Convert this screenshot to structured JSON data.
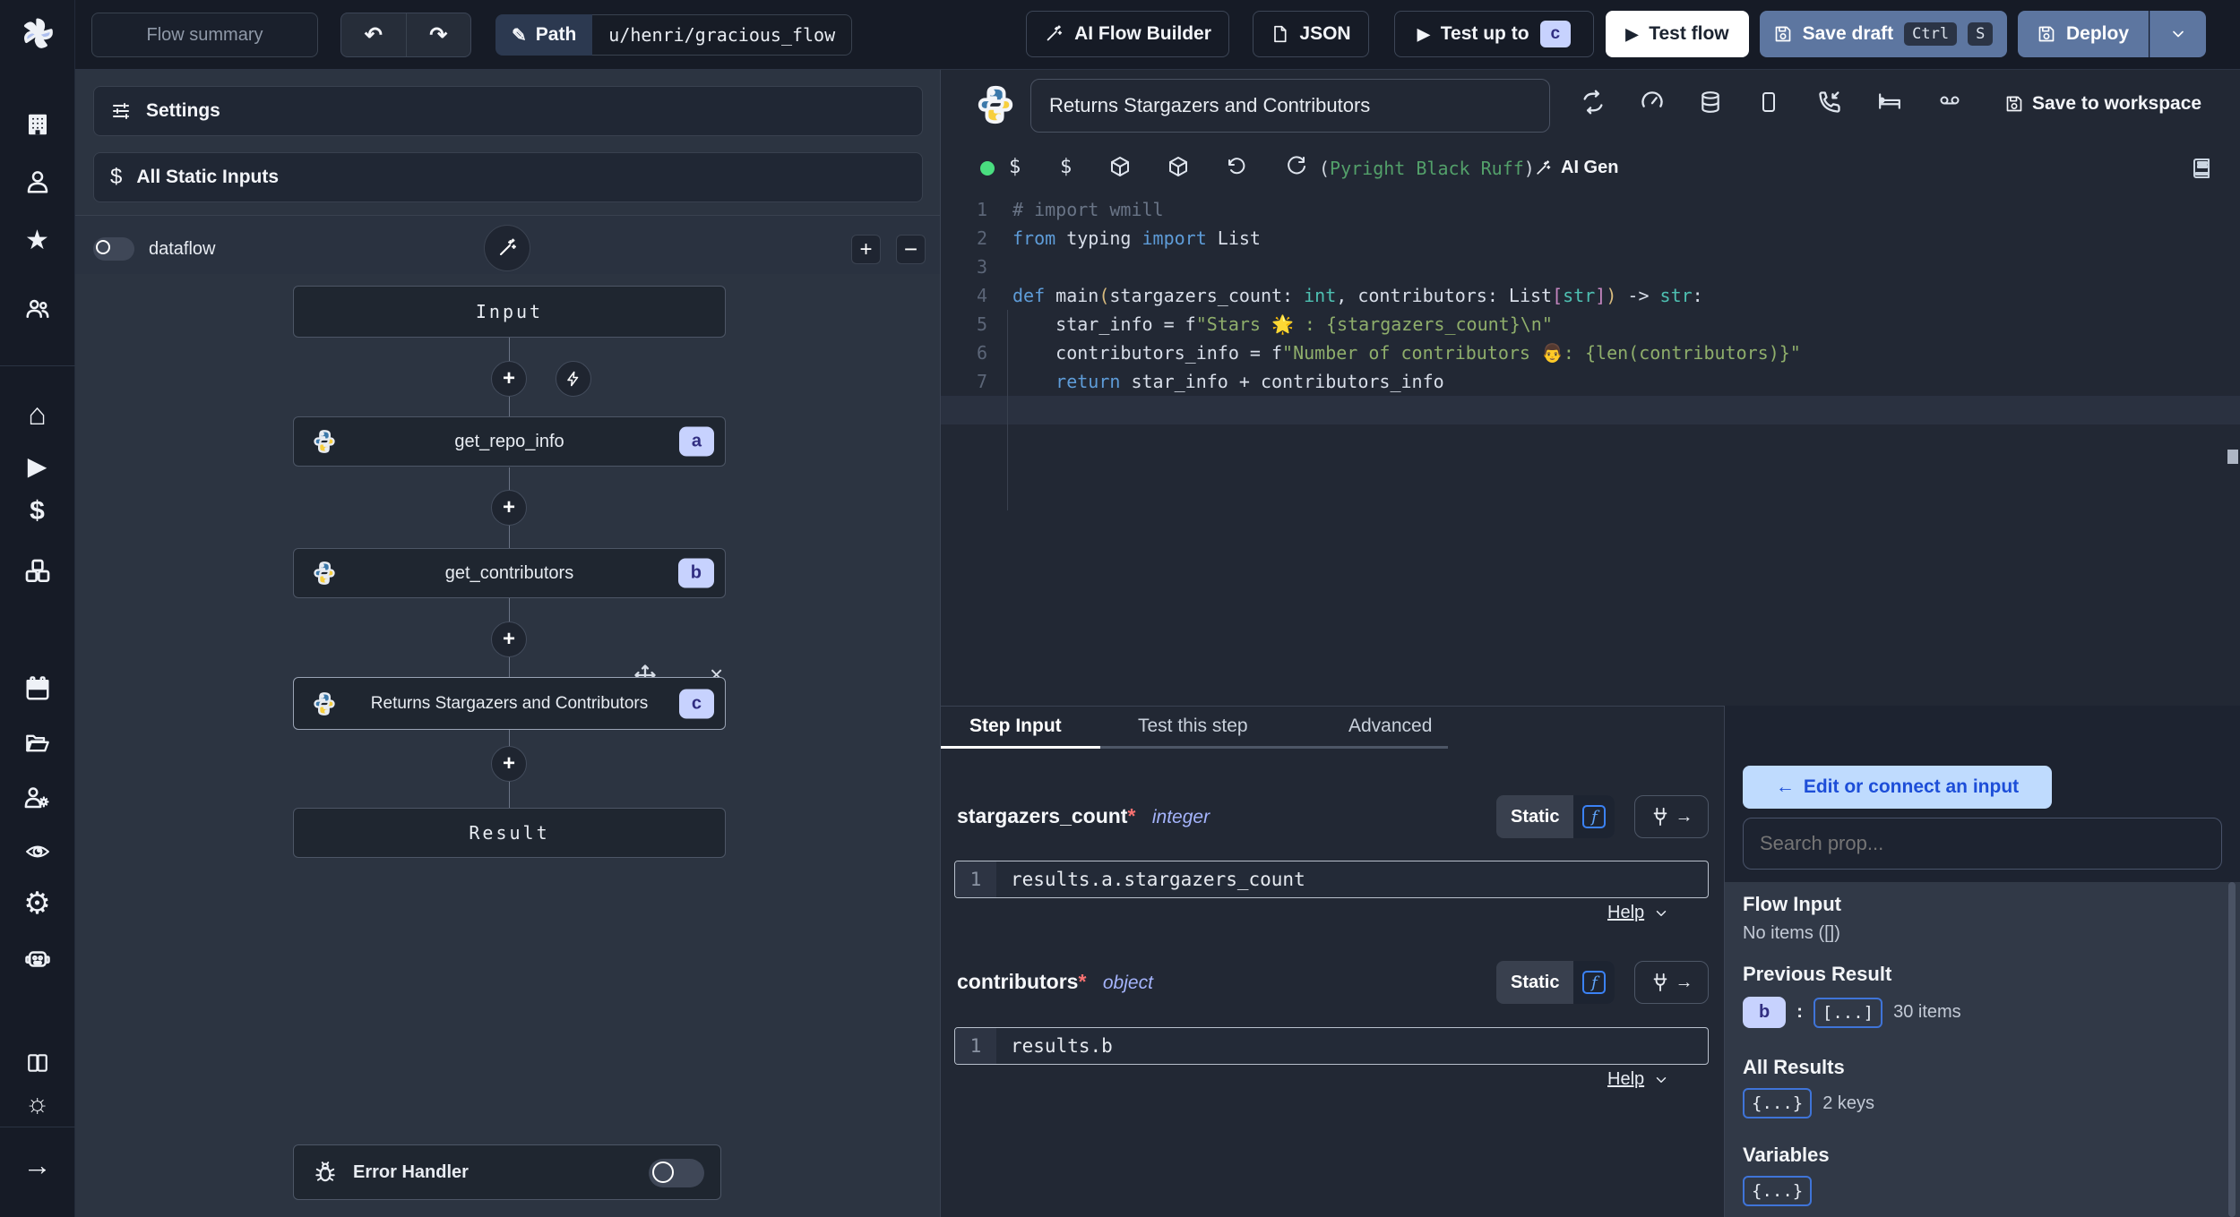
{
  "colors": {
    "topbar_bg": "#161b26",
    "panel_bg": "#2c3441",
    "editor_bg": "#222834",
    "accent_badge_bg": "#c7d2fe",
    "accent_badge_text": "#312e81",
    "primary_button": "#5d76a0",
    "connect_button_bg": "#bfdbfe",
    "connect_button_text": "#1d4ed8",
    "success_dot": "#4ade80",
    "lint_green": "#53a06a",
    "chip_border": "#3f74d8",
    "required_red": "#f87171"
  },
  "topbar": {
    "flow_summary_placeholder": "Flow summary",
    "path_label": "Path",
    "path_value": "u/henri/gracious_flow",
    "ai_flow_builder_label": "AI Flow Builder",
    "json_label": "JSON",
    "test_up_to_label": "Test up to",
    "test_up_to_badge": "c",
    "test_flow_label": "Test flow",
    "save_draft_label": "Save draft",
    "kbd_ctrl": "Ctrl",
    "kbd_s": "S",
    "deploy_label": "Deploy"
  },
  "sidebar": {
    "icons": [
      "windmill-logo",
      "building",
      "user",
      "star",
      "user-group",
      "home",
      "play",
      "dollar",
      "blocks",
      "calendar",
      "folder",
      "user-cog",
      "eye",
      "gear",
      "robot",
      "books",
      "sun",
      "arrow-right"
    ]
  },
  "flow_panel": {
    "settings_label": "Settings",
    "static_inputs_label": "All Static Inputs",
    "dataflow_label": "dataflow",
    "error_handler_label": "Error Handler",
    "graph": {
      "input_label": "Input",
      "result_label": "Result",
      "steps": [
        {
          "label": "get_repo_info",
          "badge": "a"
        },
        {
          "label": "get_contributors",
          "badge": "b"
        },
        {
          "label": "Returns Stargazers and Contributors",
          "badge": "c"
        }
      ]
    }
  },
  "editor": {
    "title": "Returns Stargazers and Contributors",
    "lint_open": "(",
    "lint_text": "Pyright Black Ruff",
    "lint_close": ")",
    "ai_gen_label": "AI Gen",
    "save_to_workspace_label": "Save to workspace",
    "code": {
      "lines": [
        [
          {
            "t": "# import wmill",
            "c": "com"
          }
        ],
        [
          {
            "t": "from",
            "c": "kw"
          },
          {
            "t": " typing ",
            "c": "pl"
          },
          {
            "t": "import",
            "c": "kw"
          },
          {
            "t": " List",
            "c": "pl"
          }
        ],
        [],
        [
          {
            "t": "def",
            "c": "kw"
          },
          {
            "t": " main",
            "c": "pl"
          },
          {
            "t": "(",
            "c": "b1"
          },
          {
            "t": "stargazers_count: ",
            "c": "pl"
          },
          {
            "t": "int",
            "c": "ty"
          },
          {
            "t": ", contributors: List",
            "c": "pl"
          },
          {
            "t": "[",
            "c": "b2"
          },
          {
            "t": "str",
            "c": "ty"
          },
          {
            "t": "]",
            "c": "b2"
          },
          {
            "t": ")",
            "c": "b1"
          },
          {
            "t": " -> ",
            "c": "pl"
          },
          {
            "t": "str",
            "c": "ty"
          },
          {
            "t": ":",
            "c": "pl"
          }
        ],
        [
          {
            "t": "    star_info = f",
            "c": "pl"
          },
          {
            "t": "\"Stars 🌟 : {stargazers_count}\\n\"",
            "c": "str"
          }
        ],
        [
          {
            "t": "    contributors_info = f",
            "c": "pl"
          },
          {
            "t": "\"Number of contributors 👨: {len(contributors)}\"",
            "c": "str"
          }
        ],
        [
          {
            "t": "    ",
            "c": "pl"
          },
          {
            "t": "return",
            "c": "kw"
          },
          {
            "t": " star_info + contributors_info",
            "c": "pl"
          }
        ],
        []
      ]
    }
  },
  "step_panel": {
    "tabs": [
      "Step Input",
      "Test this step",
      "Advanced"
    ],
    "active_tab": "Step Input",
    "fields": [
      {
        "name": "stargazers_count",
        "required": "*",
        "type": "integer",
        "mode": "Static",
        "line_no": "1",
        "expr": "results.a.stargazers_count",
        "help": "Help"
      },
      {
        "name": "contributors",
        "required": "*",
        "type": "object",
        "mode": "Static",
        "line_no": "1",
        "expr": "results.b",
        "help": "Help"
      }
    ]
  },
  "prop_picker": {
    "edit_button_arrow": "←",
    "edit_button_label": "Edit or connect an input",
    "search_placeholder": "Search prop...",
    "flow_input_title": "Flow Input",
    "flow_input_empty": "No items ([])",
    "previous_result_title": "Previous Result",
    "previous_result_badge": "b",
    "previous_result_colon": ":",
    "previous_result_chip": "[...]",
    "previous_result_count": "30 items",
    "all_results_title": "All Results",
    "all_results_chip": "{...}",
    "all_results_count": "2 keys",
    "variables_title": "Variables",
    "variables_chip": "{...}"
  }
}
